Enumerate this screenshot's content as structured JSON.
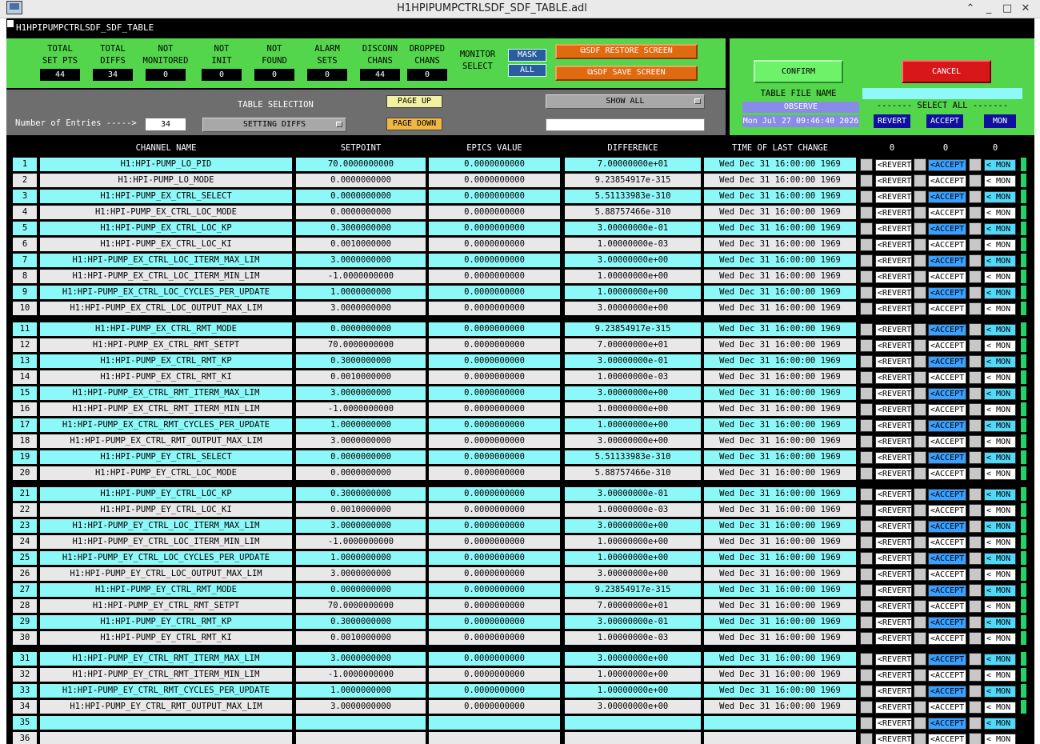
{
  "window": {
    "title": "H1HPIPUMPCTRLSDF_SDF_TABLE.adl",
    "minimize": "⌃",
    "restore": "_",
    "maximize": "□",
    "close": "✕"
  },
  "header_bar": {
    "text": "H1HPIPUMPCTRLSDF_SDF_TABLE"
  },
  "stats": [
    {
      "label1": "TOTAL",
      "label2": "SET PTS",
      "value": "44"
    },
    {
      "label1": "TOTAL",
      "label2": "DIFFS",
      "value": "34"
    },
    {
      "label1": "NOT",
      "label2": "MONITORED",
      "value": "0"
    },
    {
      "label1": "NOT",
      "label2": "INIT",
      "value": "0"
    },
    {
      "label1": "NOT",
      "label2": "FOUND",
      "value": "0"
    },
    {
      "label1": "ALARM",
      "label2": "SETS",
      "value": "0"
    },
    {
      "label1": "DISCONN",
      "label2": "CHANS",
      "value": "44"
    },
    {
      "label1": "DROPPED",
      "label2": "CHANS",
      "value": "0"
    }
  ],
  "monitor": {
    "label1": "MONITOR",
    "label2": "SELECT",
    "mask": "MASK",
    "all": "ALL"
  },
  "sdf": {
    "restore": "SDF RESTORE SCREEN",
    "save": "SDF SAVE SCREEN"
  },
  "controls": {
    "entries_label": "Number of Entries ----->",
    "entries_value": "34",
    "table_selection_label": "TABLE SELECTION",
    "table_selection_value": "SETTING DIFFS",
    "page_up": "PAGE UP",
    "page_down": "PAGE DOWN",
    "show_all": "SHOW ALL",
    "filter_value": ""
  },
  "right": {
    "confirm": "CONFIRM",
    "cancel": "CANCEL",
    "table_file_label": "TABLE FILE NAME",
    "observe": "OBSERVE",
    "timestamp": "Mon Jul 27 09:46:40 2026",
    "select_all_label": "------- SELECT ALL -------",
    "revert": "REVERT",
    "accept": "ACCEPT",
    "mon": "MON",
    "file_value": ""
  },
  "columns": {
    "channel": "CHANNEL NAME",
    "setpoint": "SETPOINT",
    "epics": "EPICS VALUE",
    "difference": "DIFFERENCE",
    "time": "TIME OF LAST CHANGE",
    "count_revert": "0",
    "count_accept": "0",
    "count_mon": "0"
  },
  "row_buttons": {
    "revert": "<REVERT",
    "accept": "<ACCEPT",
    "mon": "< MON"
  },
  "rows": [
    {
      "n": "1",
      "name": "H1:HPI-PUMP_LO_PID",
      "set": "70.0000000000",
      "epics": "0.0000000000",
      "diff": "7.00000000e+01",
      "time": "Wed Dec 31 16:00:00 1969"
    },
    {
      "n": "2",
      "name": "H1:HPI-PUMP_LO_MODE",
      "set": "0.0000000000",
      "epics": "0.0000000000",
      "diff": "9.23854917e-315",
      "time": "Wed Dec 31 16:00:00 1969"
    },
    {
      "n": "3",
      "name": "H1:HPI-PUMP_EX_CTRL_SELECT",
      "set": "0.0000000000",
      "epics": "0.0000000000",
      "diff": "5.51133983e-310",
      "time": "Wed Dec 31 16:00:00 1969"
    },
    {
      "n": "4",
      "name": "H1:HPI-PUMP_EX_CTRL_LOC_MODE",
      "set": "0.0000000000",
      "epics": "0.0000000000",
      "diff": "5.88757466e-310",
      "time": "Wed Dec 31 16:00:00 1969"
    },
    {
      "n": "5",
      "name": "H1:HPI-PUMP_EX_CTRL_LOC_KP",
      "set": "0.3000000000",
      "epics": "0.0000000000",
      "diff": "3.00000000e-01",
      "time": "Wed Dec 31 16:00:00 1969"
    },
    {
      "n": "6",
      "name": "H1:HPI-PUMP_EX_CTRL_LOC_KI",
      "set": "0.0010000000",
      "epics": "0.0000000000",
      "diff": "1.00000000e-03",
      "time": "Wed Dec 31 16:00:00 1969"
    },
    {
      "n": "7",
      "name": "H1:HPI-PUMP_EX_CTRL_LOC_ITERM_MAX_LIM",
      "set": "3.0000000000",
      "epics": "0.0000000000",
      "diff": "3.00000000e+00",
      "time": "Wed Dec 31 16:00:00 1969"
    },
    {
      "n": "8",
      "name": "H1:HPI-PUMP_EX_CTRL_LOC_ITERM_MIN_LIM",
      "set": "-1.0000000000",
      "epics": "0.0000000000",
      "diff": "1.00000000e+00",
      "time": "Wed Dec 31 16:00:00 1969"
    },
    {
      "n": "9",
      "name": "H1:HPI-PUMP_EX_CTRL_LOC_CYCLES_PER_UPDATE",
      "set": "1.0000000000",
      "epics": "0.0000000000",
      "diff": "1.00000000e+00",
      "time": "Wed Dec 31 16:00:00 1969"
    },
    {
      "n": "10",
      "name": "H1:HPI-PUMP_EX_CTRL_LOC_OUTPUT_MAX_LIM",
      "set": "3.0000000000",
      "epics": "0.0000000000",
      "diff": "3.00000000e+00",
      "time": "Wed Dec 31 16:00:00 1969"
    },
    {
      "n": "11",
      "name": "H1:HPI-PUMP_EX_CTRL_RMT_MODE",
      "set": "0.0000000000",
      "epics": "0.0000000000",
      "diff": "9.23854917e-315",
      "time": "Wed Dec 31 16:00:00 1969"
    },
    {
      "n": "12",
      "name": "H1:HPI-PUMP_EX_CTRL_RMT_SETPT",
      "set": "70.0000000000",
      "epics": "0.0000000000",
      "diff": "7.00000000e+01",
      "time": "Wed Dec 31 16:00:00 1969"
    },
    {
      "n": "13",
      "name": "H1:HPI-PUMP_EX_CTRL_RMT_KP",
      "set": "0.3000000000",
      "epics": "0.0000000000",
      "diff": "3.00000000e-01",
      "time": "Wed Dec 31 16:00:00 1969"
    },
    {
      "n": "14",
      "name": "H1:HPI-PUMP_EX_CTRL_RMT_KI",
      "set": "0.0010000000",
      "epics": "0.0000000000",
      "diff": "1.00000000e-03",
      "time": "Wed Dec 31 16:00:00 1969"
    },
    {
      "n": "15",
      "name": "H1:HPI-PUMP_EX_CTRL_RMT_ITERM_MAX_LIM",
      "set": "3.0000000000",
      "epics": "0.0000000000",
      "diff": "3.00000000e+00",
      "time": "Wed Dec 31 16:00:00 1969"
    },
    {
      "n": "16",
      "name": "H1:HPI-PUMP_EX_CTRL_RMT_ITERM_MIN_LIM",
      "set": "-1.0000000000",
      "epics": "0.0000000000",
      "diff": "1.00000000e+00",
      "time": "Wed Dec 31 16:00:00 1969"
    },
    {
      "n": "17",
      "name": "H1:HPI-PUMP_EX_CTRL_RMT_CYCLES_PER_UPDATE",
      "set": "1.0000000000",
      "epics": "0.0000000000",
      "diff": "1.00000000e+00",
      "time": "Wed Dec 31 16:00:00 1969"
    },
    {
      "n": "18",
      "name": "H1:HPI-PUMP_EX_CTRL_RMT_OUTPUT_MAX_LIM",
      "set": "3.0000000000",
      "epics": "0.0000000000",
      "diff": "3.00000000e+00",
      "time": "Wed Dec 31 16:00:00 1969"
    },
    {
      "n": "19",
      "name": "H1:HPI-PUMP_EY_CTRL_SELECT",
      "set": "0.0000000000",
      "epics": "0.0000000000",
      "diff": "5.51133983e-310",
      "time": "Wed Dec 31 16:00:00 1969"
    },
    {
      "n": "20",
      "name": "H1:HPI-PUMP_EY_CTRL_LOC_MODE",
      "set": "0.0000000000",
      "epics": "0.0000000000",
      "diff": "5.88757466e-310",
      "time": "Wed Dec 31 16:00:00 1969"
    },
    {
      "n": "21",
      "name": "H1:HPI-PUMP_EY_CTRL_LOC_KP",
      "set": "0.3000000000",
      "epics": "0.0000000000",
      "diff": "3.00000000e-01",
      "time": "Wed Dec 31 16:00:00 1969"
    },
    {
      "n": "22",
      "name": "H1:HPI-PUMP_EY_CTRL_LOC_KI",
      "set": "0.0010000000",
      "epics": "0.0000000000",
      "diff": "1.00000000e-03",
      "time": "Wed Dec 31 16:00:00 1969"
    },
    {
      "n": "23",
      "name": "H1:HPI-PUMP_EY_CTRL_LOC_ITERM_MAX_LIM",
      "set": "3.0000000000",
      "epics": "0.0000000000",
      "diff": "3.00000000e+00",
      "time": "Wed Dec 31 16:00:00 1969"
    },
    {
      "n": "24",
      "name": "H1:HPI-PUMP_EY_CTRL_LOC_ITERM_MIN_LIM",
      "set": "-1.0000000000",
      "epics": "0.0000000000",
      "diff": "1.00000000e+00",
      "time": "Wed Dec 31 16:00:00 1969"
    },
    {
      "n": "25",
      "name": "H1:HPI-PUMP_EY_CTRL_LOC_CYCLES_PER_UPDATE",
      "set": "1.0000000000",
      "epics": "0.0000000000",
      "diff": "1.00000000e+00",
      "time": "Wed Dec 31 16:00:00 1969"
    },
    {
      "n": "26",
      "name": "H1:HPI-PUMP_EY_CTRL_LOC_OUTPUT_MAX_LIM",
      "set": "3.0000000000",
      "epics": "0.0000000000",
      "diff": "3.00000000e+00",
      "time": "Wed Dec 31 16:00:00 1969"
    },
    {
      "n": "27",
      "name": "H1:HPI-PUMP_EY_CTRL_RMT_MODE",
      "set": "0.0000000000",
      "epics": "0.0000000000",
      "diff": "9.23854917e-315",
      "time": "Wed Dec 31 16:00:00 1969"
    },
    {
      "n": "28",
      "name": "H1:HPI-PUMP_EY_CTRL_RMT_SETPT",
      "set": "70.0000000000",
      "epics": "0.0000000000",
      "diff": "7.00000000e+01",
      "time": "Wed Dec 31 16:00:00 1969"
    },
    {
      "n": "29",
      "name": "H1:HPI-PUMP_EY_CTRL_RMT_KP",
      "set": "0.3000000000",
      "epics": "0.0000000000",
      "diff": "3.00000000e-01",
      "time": "Wed Dec 31 16:00:00 1969"
    },
    {
      "n": "30",
      "name": "H1:HPI-PUMP_EY_CTRL_RMT_KI",
      "set": "0.0010000000",
      "epics": "0.0000000000",
      "diff": "1.00000000e-03",
      "time": "Wed Dec 31 16:00:00 1969"
    },
    {
      "n": "31",
      "name": "H1:HPI-PUMP_EY_CTRL_RMT_ITERM_MAX_LIM",
      "set": "3.0000000000",
      "epics": "0.0000000000",
      "diff": "3.00000000e+00",
      "time": "Wed Dec 31 16:00:00 1969"
    },
    {
      "n": "32",
      "name": "H1:HPI-PUMP_EY_CTRL_RMT_ITERM_MIN_LIM",
      "set": "-1.0000000000",
      "epics": "0.0000000000",
      "diff": "1.00000000e+00",
      "time": "Wed Dec 31 16:00:00 1969"
    },
    {
      "n": "33",
      "name": "H1:HPI-PUMP_EY_CTRL_RMT_CYCLES_PER_UPDATE",
      "set": "1.0000000000",
      "epics": "0.0000000000",
      "diff": "1.00000000e+00",
      "time": "Wed Dec 31 16:00:00 1969"
    },
    {
      "n": "34",
      "name": "H1:HPI-PUMP_EY_CTRL_RMT_OUTPUT_MAX_LIM",
      "set": "3.0000000000",
      "epics": "0.0000000000",
      "diff": "3.00000000e+00",
      "time": "Wed Dec 31 16:00:00 1969"
    },
    {
      "n": "35",
      "name": "",
      "set": "",
      "epics": "",
      "diff": "",
      "time": ""
    },
    {
      "n": "36",
      "name": "",
      "set": "",
      "epics": "",
      "diff": "",
      "time": ""
    }
  ],
  "colors": {
    "panel_green": "#54d64c",
    "row_cyan": "#8cf8f8",
    "row_gray": "#e8e8e8",
    "accept_blue": "#3aa0ff",
    "mon_cyan": "#52d8f8",
    "orange": "#e06a10"
  }
}
